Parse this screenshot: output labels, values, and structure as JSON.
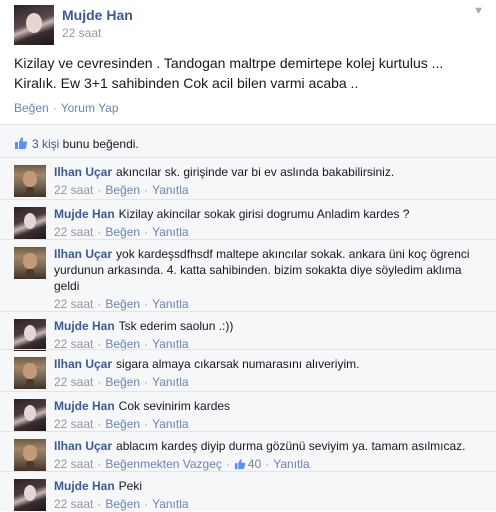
{
  "post": {
    "author": "Mujde Han",
    "time": "22 saat",
    "text_line1": "Kizilay ve cevresinden . Tandogan maltrpe demirtepe kolej kurtulus ...",
    "text_line2": "Kiralık. Ew 3+1 sahibinden Cok acil bilen varmi acaba ..",
    "like_label": "Beğen",
    "comment_label": "Yorum Yap"
  },
  "likes": {
    "count_text": "3 kişi",
    "suffix": " bunu beğendi."
  },
  "comments": [
    {
      "author": "Ilhan Uçar",
      "text": "akıncılar sk. girişinde var bi ev aslında bakabilirsiniz.",
      "time": "22 saat",
      "like": "Beğen",
      "reply": "Yanıtla"
    },
    {
      "author": "Mujde Han",
      "text": "Kizilay akincilar sokak girisi dogrumu Anladim kardes ?",
      "time": "22 saat",
      "like": "Beğen",
      "reply": "Yanıtla"
    },
    {
      "author": "Ilhan Uçar",
      "text": "yok kardeşsdfhsdf maltepe akıncılar sokak. ankara üni koç ögrenci yurdunun arkasında. 4. katta sahibinden. bizim sokakta diye söyledim aklıma geldi",
      "time": "22 saat",
      "like": "Beğen",
      "reply": "Yanıtla"
    },
    {
      "author": "Mujde Han",
      "text": "Tsk ederim saolun .:))",
      "time": "22 saat",
      "like": "Beğen",
      "reply": "Yanıtla"
    },
    {
      "author": "Ilhan Uçar",
      "text": "sigara almaya cıkarsak numarasını alıveriyim.",
      "time": "22 saat",
      "like": "Beğen",
      "reply": "Yanıtla"
    },
    {
      "author": "Mujde Han",
      "text": "Cok sevinirim kardes",
      "time": "22 saat",
      "like": "Beğen",
      "reply": "Yanıtla"
    },
    {
      "author": "Ilhan Uçar",
      "text": "ablacım kardeş diyip durma gözünü seviyim ya. tamam asılmıcaz.",
      "time": "22 saat",
      "like": "Beğenmekten Vazgeç",
      "likes": "40",
      "reply": "Yanıtla"
    },
    {
      "author": "Mujde Han",
      "text": "Peki",
      "time": "22 saat",
      "like": "Beğen",
      "reply": "Yanıtla"
    }
  ],
  "colors": {
    "link": "#3b5998",
    "meta": "#9197a3",
    "background": "#f6f7f8"
  }
}
